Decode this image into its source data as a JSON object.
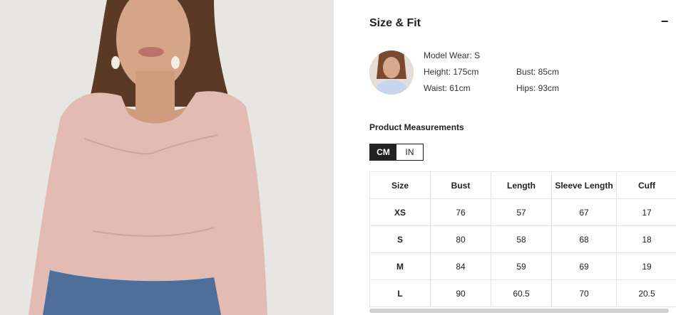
{
  "section": {
    "title": "Size & Fit",
    "collapse_symbol": "−"
  },
  "model": {
    "wear": "Model Wear: S",
    "height": "Height: 175cm",
    "bust": "Bust: 85cm",
    "waist": "Waist: 61cm",
    "hips": "Hips: 93cm"
  },
  "measurements": {
    "title": "Product Measurements",
    "units": [
      "CM",
      "IN"
    ],
    "selected_unit": "CM",
    "headers": [
      "Size",
      "Bust",
      "Length",
      "Sleeve Length",
      "Cuff"
    ],
    "rows": [
      [
        "XS",
        "76",
        "57",
        "67",
        "17"
      ],
      [
        "S",
        "80",
        "58",
        "68",
        "18"
      ],
      [
        "M",
        "84",
        "59",
        "69",
        "19"
      ],
      [
        "L",
        "90",
        "60.5",
        "70",
        "20.5"
      ]
    ]
  }
}
